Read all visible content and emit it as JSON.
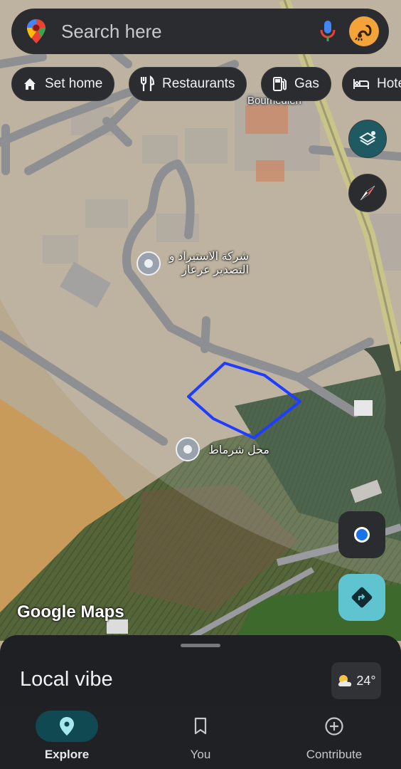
{
  "search": {
    "placeholder": "Search here",
    "avatar_icon": "scorpion-avatar"
  },
  "chips": [
    {
      "label": "Set home",
      "icon": "home-icon"
    },
    {
      "label": "Restaurants",
      "icon": "fork-knife-icon"
    },
    {
      "label": "Gas",
      "icon": "gas-station-icon"
    },
    {
      "label": "Hote",
      "icon": "bed-icon"
    }
  ],
  "map": {
    "labels": [
      {
        "text": "شركة الاستيراد و التصدير عرعار"
      },
      {
        "text": "محل شرماط"
      },
      {
        "text": "Boumedien"
      }
    ],
    "logo": "Google Maps",
    "polygon_color": "#1f3dff"
  },
  "bottom_sheet": {
    "title": "Local vibe",
    "weather": "24°"
  },
  "nav": [
    {
      "label": "Explore",
      "active": true
    },
    {
      "label": "You",
      "active": false
    },
    {
      "label": "Contribute",
      "active": false
    }
  ]
}
